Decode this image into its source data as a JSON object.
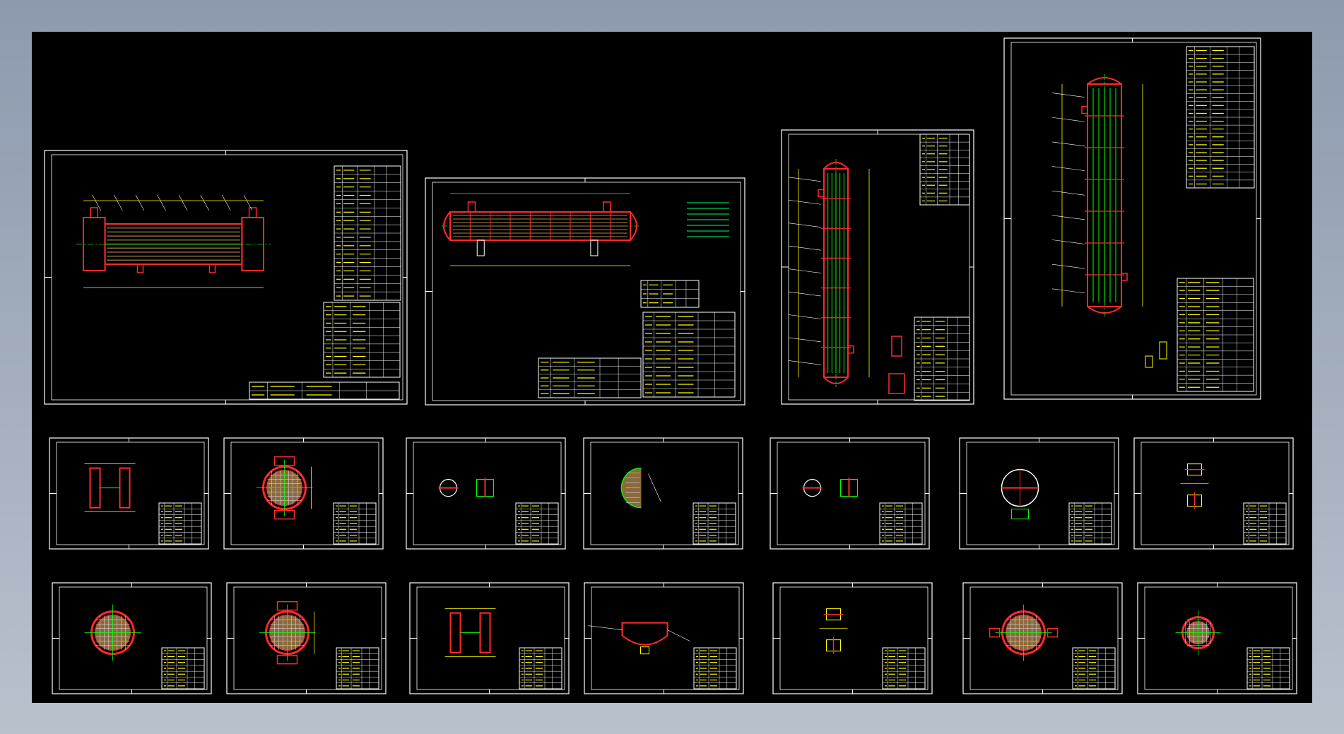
{
  "viewport": {
    "background_top": "#8d9aae",
    "background_bottom": "#b9c1cd",
    "canvas_color": "#000000"
  },
  "palette": {
    "frame": "#ffffff",
    "inner_frame": "#2a3cff",
    "vessel": "#ff2a2a",
    "dimension": "#ffff00",
    "centerline": "#00ff00",
    "tube_fill": "#8a6a3a",
    "annotation": "#00ff66"
  },
  "drawing_sheets": {
    "large": [
      {
        "name": "horizontal-exchanger-assembly",
        "view": "horizontal"
      },
      {
        "name": "horizontal-condenser-assembly",
        "view": "horizontal-long"
      },
      {
        "name": "vertical-exchanger-assembly",
        "view": "vertical"
      },
      {
        "name": "vertical-column-assembly",
        "view": "vertical-tall"
      }
    ],
    "detail_row_1": [
      {
        "name": "channel-box-detail",
        "view": "channel"
      },
      {
        "name": "shell-flange-section",
        "view": "shell-section"
      },
      {
        "name": "nozzle-details",
        "view": "two-nozzles"
      },
      {
        "name": "tubesheet-detail",
        "view": "tubesheet"
      },
      {
        "name": "flange-details",
        "view": "two-flanges"
      },
      {
        "name": "cover-section",
        "view": "cover"
      },
      {
        "name": "support-details",
        "view": "small-parts"
      }
    ],
    "detail_row_2": [
      {
        "name": "baffle-plate-detail",
        "view": "baffle"
      },
      {
        "name": "shell-nozzle-section",
        "view": "shell-section"
      },
      {
        "name": "channel-cover-detail",
        "view": "channel"
      },
      {
        "name": "head-assembly-detail",
        "view": "head"
      },
      {
        "name": "small-parts-detail",
        "view": "small-parts"
      },
      {
        "name": "tube-bundle-section",
        "view": "bundle"
      },
      {
        "name": "ring-flange-detail",
        "view": "ring"
      }
    ]
  }
}
